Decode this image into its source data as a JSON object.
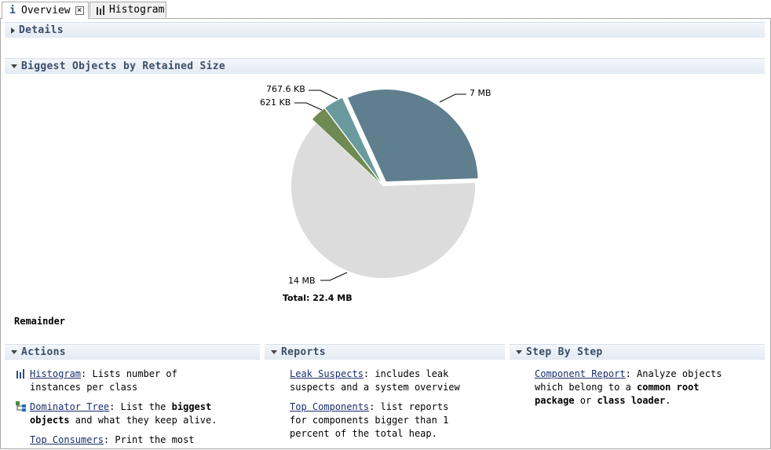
{
  "tabs": [
    {
      "label": "Overview",
      "icon": "info-icon",
      "active": true
    },
    {
      "label": "Histogram",
      "icon": "histogram-icon",
      "active": false
    }
  ],
  "details_section": {
    "title": "Details",
    "expanded": false
  },
  "biggest_section": {
    "title": "Biggest Objects by Retained Size",
    "expanded": true
  },
  "pie": {
    "slices": [
      {
        "label": "7 MB",
        "value": 7.0,
        "color": "#5f7f8f",
        "exploded": true
      },
      {
        "label": "14 MB",
        "value": 14.0,
        "color": "#dcdcdc",
        "exploded": false
      },
      {
        "label": "621 KB",
        "value": 0.621,
        "color": "#6f8a52",
        "exploded": true
      },
      {
        "label": "767.6 KB",
        "value": 0.7676,
        "color": "#6b9a9e",
        "exploded": true
      }
    ],
    "total": "Total: 22.4 MB"
  },
  "remainder_label": "Remainder",
  "actions": {
    "title": "Actions",
    "items": [
      {
        "link": "Histogram",
        "text_a": ": Lists number of",
        "text_b": "instances per class"
      },
      {
        "link": "Dominator Tree",
        "text_a": ": List the ",
        "bold_a": "biggest",
        "bold_b": "objects",
        "text_b": " and what they keep alive."
      },
      {
        "link": "Top Consumers",
        "text_a": ": Print the most"
      }
    ]
  },
  "reports": {
    "title": "Reports",
    "items": [
      {
        "link": "Leak Suspects",
        "text_a": ": includes leak",
        "text_b": "suspects and a system overview"
      },
      {
        "link": "Top Components",
        "text_a": ": list reports",
        "text_b": "for components bigger than 1",
        "text_c": "percent of the total heap."
      }
    ]
  },
  "step_by_step": {
    "title": "Step By Step",
    "items": [
      {
        "link": "Component Report",
        "text_a": ": Analyze objects",
        "text_b": "which belong to a ",
        "bold_b": "common root",
        "bold_c": "package",
        "text_c": " or ",
        "bold_d": "class loader",
        "text_d": "."
      }
    ]
  }
}
